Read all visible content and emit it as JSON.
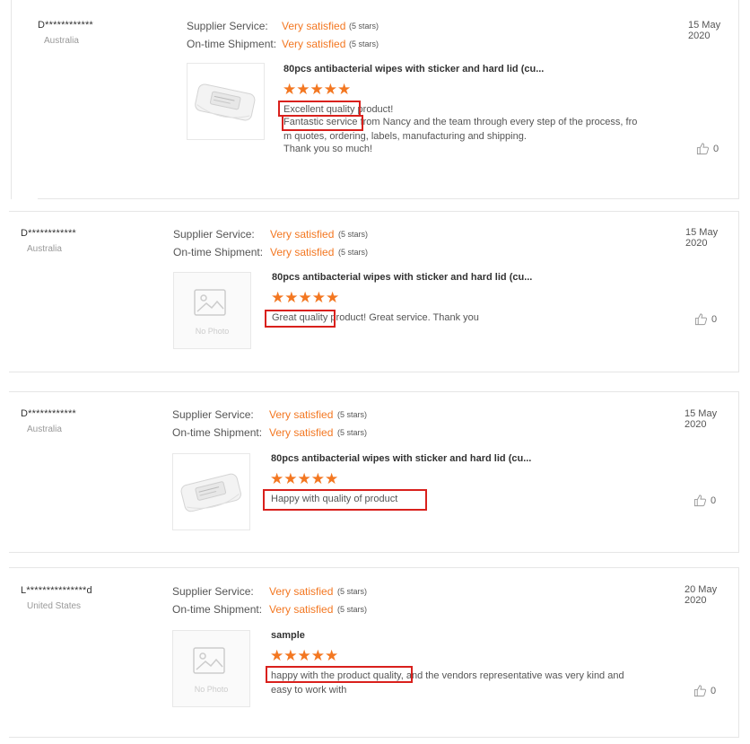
{
  "labels": {
    "supplier_service": "Supplier Service:",
    "on_time_shipment": "On-time Shipment:",
    "rating_value": "Very satisfied",
    "rating_stars_note": "(5 stars)",
    "no_photo": "No Photo"
  },
  "star_glyphs": "★★★★★",
  "accent_color": "#f37721",
  "highlight_color": "#d9201c",
  "reviews": [
    {
      "buyer": "D************",
      "country": "Australia",
      "date": "15 May 2020",
      "product_title": "80pcs antibacterial wipes with sticker and hard lid (cu...",
      "product_image": "wipes-pack",
      "rating_stars": 5,
      "text_lines": [
        "Excellent quality product!",
        "Fantastic service from Nancy and the team through every step of the process, fro",
        "m quotes, ordering, labels, manufacturing and shipping.",
        "Thank you so much!"
      ],
      "likes": "0"
    },
    {
      "buyer": "D************",
      "country": "Australia",
      "date": "15 May 2020",
      "product_title": "80pcs antibacterial wipes with sticker and hard lid (cu...",
      "product_image": "no-photo",
      "rating_stars": 5,
      "text_lines": [
        "Great quality product! Great service. Thank you"
      ],
      "likes": "0"
    },
    {
      "buyer": "D************",
      "country": "Australia",
      "date": "15 May 2020",
      "product_title": "80pcs antibacterial wipes with sticker and hard lid (cu...",
      "product_image": "wipes-pack",
      "rating_stars": 5,
      "text_lines": [
        "Happy with quality of product"
      ],
      "likes": "0"
    },
    {
      "buyer": "L***************d",
      "country": "United States",
      "date": "20 May 2020",
      "product_title": "sample",
      "product_image": "no-photo",
      "rating_stars": 5,
      "text_lines": [
        "happy with the product quality, and the vendors representative was very kind and",
        "easy to work with"
      ],
      "likes": "0"
    }
  ]
}
